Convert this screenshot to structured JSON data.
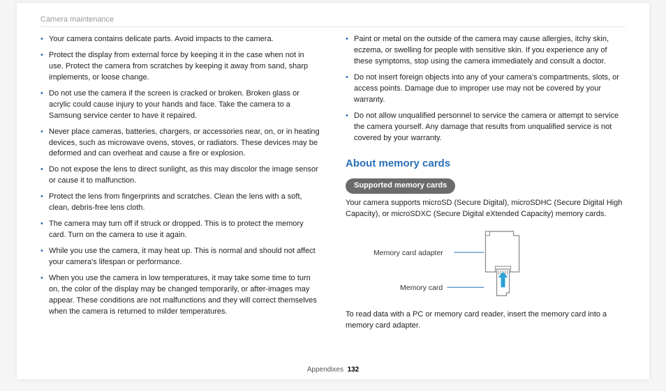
{
  "breadcrumb": "Camera maintenance",
  "left_bullets": [
    "Your camera contains delicate parts. Avoid impacts to the camera.",
    "Protect the display from external force by keeping it in the case when not in use. Protect the camera from scratches by keeping it away from sand, sharp implements, or loose change.",
    "Do not use the camera if the screen is cracked or broken. Broken glass or acrylic could cause injury to your hands and face. Take the camera to a Samsung service center to have it repaired.",
    "Never place cameras, batteries, chargers, or accessories near, on, or in heating devices, such as microwave ovens, stoves, or radiators. These devices may be deformed and can overheat and cause a fire or explosion.",
    "Do not expose the lens to direct sunlight, as this may discolor the image sensor or cause it to malfunction.",
    "Protect the lens from fingerprints and scratches. Clean the lens with a soft, clean, debris-free lens cloth.",
    "The camera may turn off if struck or dropped. This is to protect the memory card. Turn on the camera to use it again.",
    "While you use the camera, it may heat up. This is normal and should not affect your camera's lifespan or performance.",
    "When you use the camera in low temperatures, it may take some time to turn on, the color of the display may be changed temporarily, or after-images may appear. These conditions are not malfunctions and they will correct themselves when the camera is returned to milder temperatures."
  ],
  "right_bullets": [
    "Paint or metal on the outside of the camera may cause allergies, itchy skin, eczema, or swelling for people with sensitive skin. If you experience any of these symptoms, stop using the camera immediately and consult a doctor.",
    "Do not insert foreign objects into any of your camera's compartments, slots, or access points. Damage due to improper use may not be covered by your warranty.",
    "Do not allow unqualified personnel to service the camera or attempt to service the camera yourself. Any damage that results from unqualified service is not covered by your warranty."
  ],
  "section_heading": "About memory cards",
  "pill_label": "Supported memory cards",
  "supported_text": "Your camera supports microSD (Secure Digital), microSDHC (Secure Digital High Capacity), or microSDXC (Secure Digital eXtended Capacity) memory cards.",
  "diagram": {
    "adapter_label": "Memory card adapter",
    "card_label": "Memory card"
  },
  "after_diagram_text": "To read data with a PC or memory card reader, insert the memory card into a memory card adapter.",
  "footer": {
    "section": "Appendixes",
    "page": "132"
  }
}
